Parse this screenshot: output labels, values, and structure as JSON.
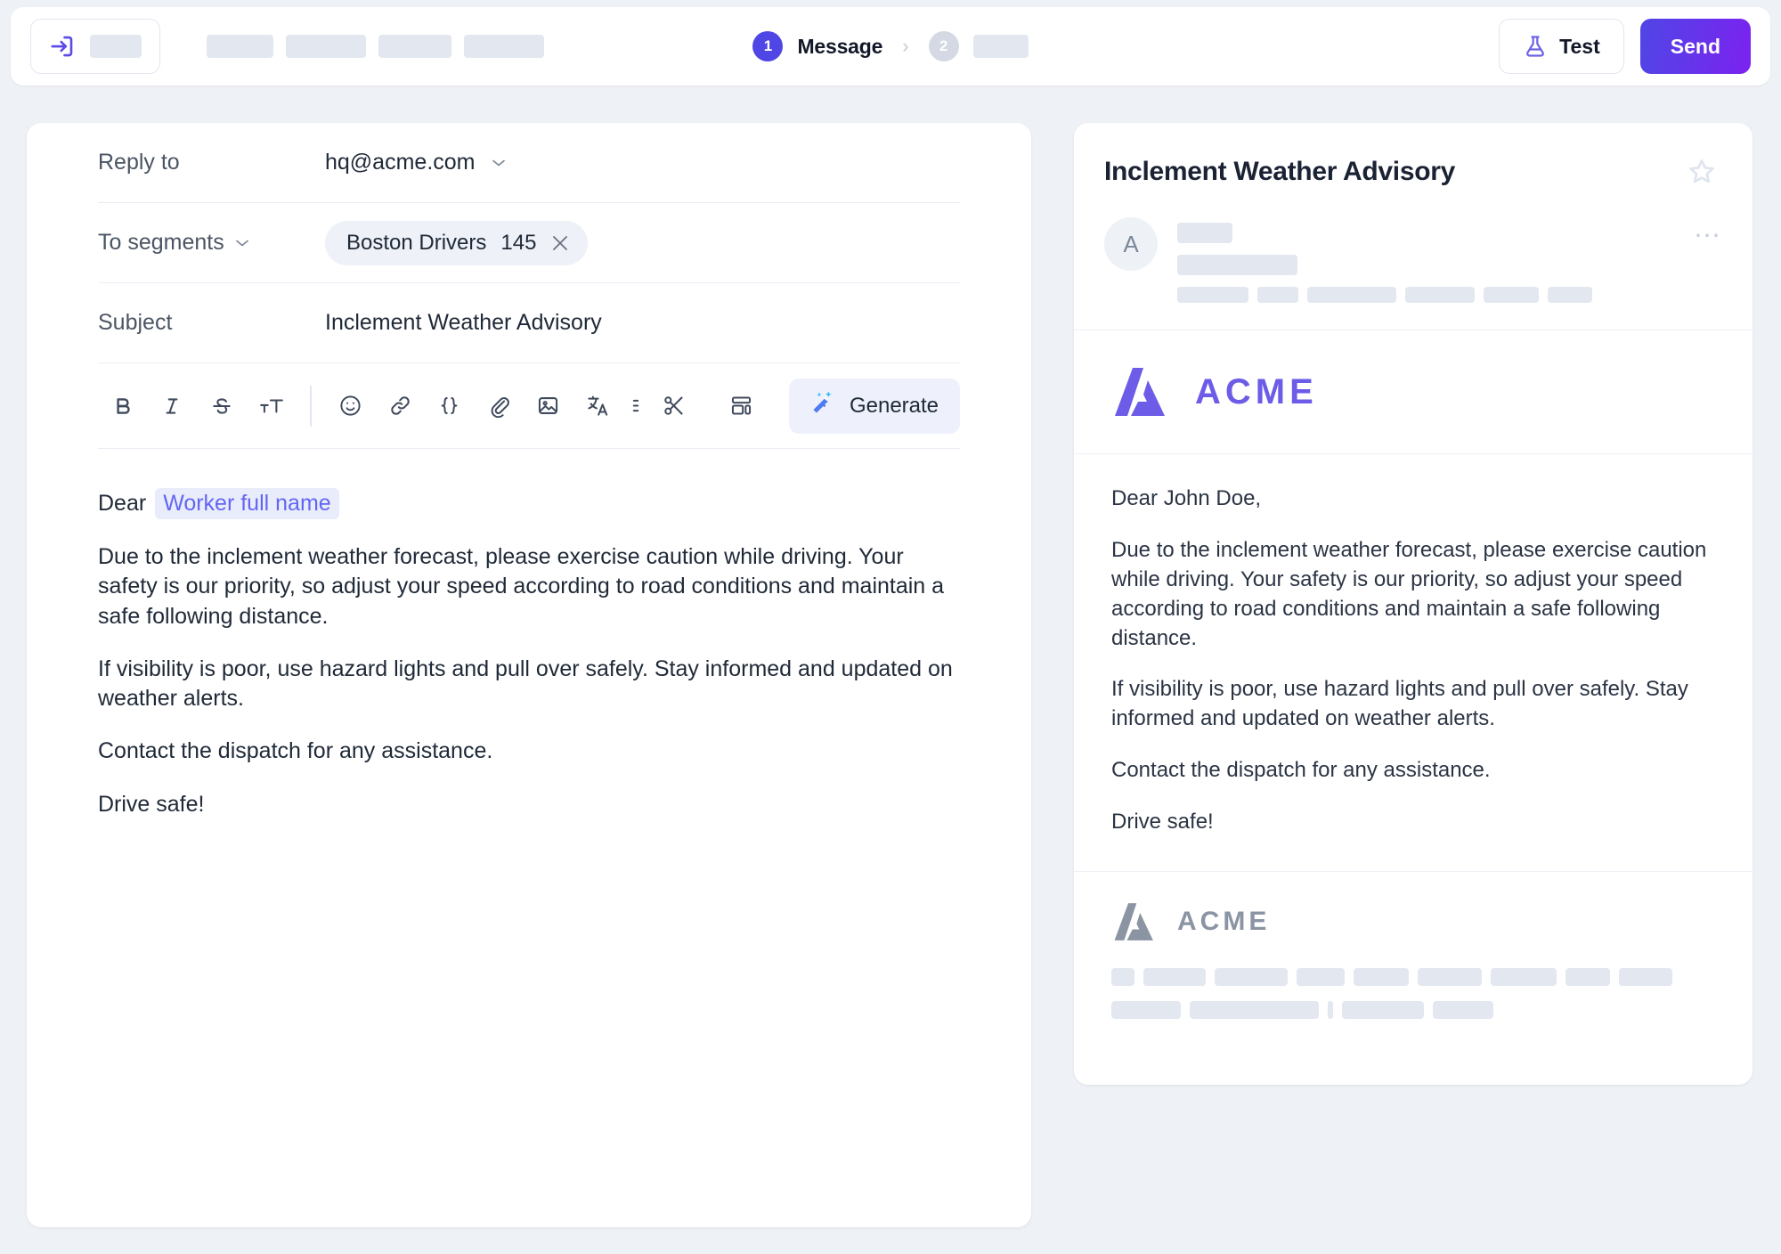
{
  "topbar": {
    "account_icon": "login-icon",
    "account_skeleton_width": 58,
    "nav_skeletons": [
      75,
      90,
      82,
      90
    ],
    "steps": [
      {
        "num": "1",
        "label": "Message",
        "active": true
      },
      {
        "num": "2",
        "label": "",
        "active": false,
        "skeleton_width": 62
      }
    ],
    "chevron": "›",
    "test_label": "Test",
    "test_icon": "flask-icon",
    "send_label": "Send",
    "accent_color": "#4f46e5",
    "send_gradient_end": "#7c22f0"
  },
  "editor": {
    "reply_to": {
      "label": "Reply to",
      "value": "hq@acme.com"
    },
    "to_segments": {
      "label": "To segments",
      "chip": {
        "name": "Boston Drivers",
        "count": "145"
      }
    },
    "subject": {
      "label": "Subject",
      "value": "Inclement Weather Advisory"
    },
    "toolbar": {
      "bold": "B",
      "italic": "I",
      "strikethrough": "S",
      "font_size": "tT",
      "icons": [
        "bold-icon",
        "italic-icon",
        "strikethrough-icon",
        "font-size-icon",
        "emoji-icon",
        "link-icon",
        "code-braces-icon",
        "attachment-icon",
        "image-icon",
        "translate-icon",
        "more-vertical-icon",
        "scissors-icon",
        "layout-template-icon"
      ],
      "generate_label": "Generate",
      "generate_icon": "magic-wand-icon"
    },
    "body": {
      "greeting_prefix": "Dear",
      "greeting_token": "Worker full name",
      "paragraphs": [
        "Due to the inclement weather forecast, please exercise caution while driving. Your safety is our priority, so adjust your speed according to road conditions and maintain a safe following distance.",
        "If visibility is poor, use hazard lights and pull over safely. Stay informed and updated on weather alerts.",
        "Contact the dispatch for any assistance.",
        "Drive safe!"
      ]
    }
  },
  "preview": {
    "title": "Inclement Weather Advisory",
    "star_icon": "star-icon",
    "more_icon": "more-horizontal-icon",
    "avatar_initial": "A",
    "meta_skeletons": {
      "line1_width": 62,
      "line2_width": 135
    },
    "meta_chips": [
      80,
      46,
      100,
      78,
      62,
      50
    ],
    "brand": {
      "name": "ACME",
      "color": "#6c5ce7",
      "logo": "acme-logo-mark"
    },
    "email": {
      "salutation": "Dear John Doe,",
      "paragraphs": [
        "Due to the inclement weather forecast, please exercise caution while driving. Your safety is our priority, so adjust your speed according to road conditions and maintain a safe following distance.",
        "If visibility is poor, use hazard lights and pull over safely. Stay informed and updated on weather alerts.",
        "Contact the dispatch for any assistance.",
        "Drive safe!"
      ]
    },
    "footer": {
      "brand_name": "ACME",
      "brand_color": "#8b94a3",
      "row1": [
        26,
        70,
        82,
        54,
        62,
        72,
        74,
        50,
        60
      ],
      "row2": [
        78,
        145,
        6,
        92,
        68
      ]
    }
  }
}
